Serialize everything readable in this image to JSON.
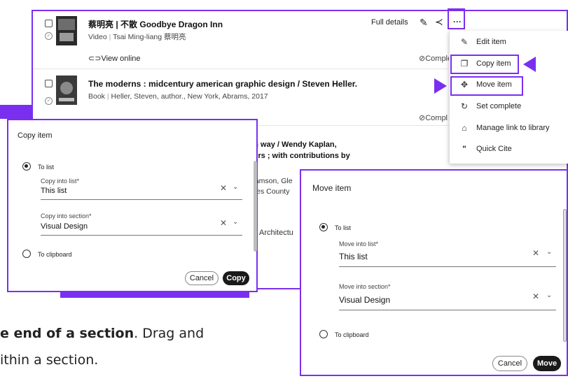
{
  "list": {
    "items": [
      {
        "title": "蔡明亮 | 不散 Goodbye Dragon Inn",
        "meta_type": "Video",
        "meta_author": "Tsai Ming-liang 蔡明亮",
        "link": "View online",
        "status": "Comple"
      },
      {
        "title": "The moderns : midcentury american graphic design / Steven Heller.",
        "meta_type": "Book",
        "meta_author": "Heller, Steven, author., New York, Abrams, 2017",
        "status": "Compl"
      }
    ],
    "fragments": {
      "line1": "rn way / Wendy Kaplan,",
      "line2": "tors ; with contributions by",
      "line3": "damson, Gle",
      "line4": "eles County",
      "line5": "Architectu"
    },
    "actions": {
      "full_details": "Full details"
    }
  },
  "menu": {
    "items": [
      {
        "label": "Edit item",
        "icon": "pencil-icon"
      },
      {
        "label": "Copy item",
        "icon": "copy-icon"
      },
      {
        "label": "Move item",
        "icon": "move-icon"
      },
      {
        "label": "Set complete",
        "icon": "refresh-icon"
      },
      {
        "label": "Manage link to library",
        "icon": "library-icon"
      },
      {
        "label": "Quick Cite",
        "icon": "quote-icon"
      }
    ]
  },
  "copy_dialog": {
    "title": "Copy item",
    "option_list": "To list",
    "list_label": "Copy into list*",
    "list_value": "This list",
    "section_label": "Copy into section*",
    "section_value": "Visual Design",
    "option_clipboard": "To clipboard",
    "cancel": "Cancel",
    "confirm": "Copy"
  },
  "move_dialog": {
    "title": "Move item",
    "option_list": "To list",
    "list_label": "Move into list*",
    "list_value": "This list",
    "section_label": "Move into section*",
    "section_value": "Visual Design",
    "option_clipboard": "To clipboard",
    "cancel": "Cancel",
    "confirm": "Move"
  },
  "background_text": {
    "line1_bold": "e end of a section",
    "line1_rest": ". Drag and",
    "line2": "ithin a section."
  },
  "colors": {
    "accent": "#7a2ff0",
    "primary_button": "#1a1a1a"
  }
}
